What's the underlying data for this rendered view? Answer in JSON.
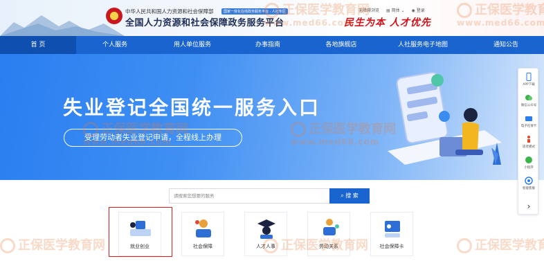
{
  "header": {
    "ministry": "中华人民共和国人力资源和社会保障部",
    "platform_title": "全国人力资源和社会保障政务服务平台",
    "tagline": "国家一体化在线政务服务平台 · 人社专区",
    "slogan": "民生为本 人才优先",
    "links": [
      "无障碍浏览",
      "简体",
      "登录"
    ]
  },
  "nav": {
    "items": [
      "首 页",
      "个人服务",
      "用人单位服务",
      "办事指南",
      "各地旗舰店",
      "人社服务电子地图",
      "通知公告"
    ],
    "active_index": 0
  },
  "banner": {
    "title": "失业登记全国统一服务入口",
    "subtitle": "受理劳动者失业登记申请，全程线上办理"
  },
  "side_tools": {
    "items": [
      "APP下载",
      "微信公众号",
      "电子社保卡",
      "适老模式",
      "小程序",
      "智能客服"
    ]
  },
  "search": {
    "placeholder": "请搜索您想要的服务",
    "button_label": "搜 索"
  },
  "services": {
    "items": [
      "就业创业",
      "社会保障",
      "人才人事",
      "劳动关系",
      "社会保障卡"
    ],
    "highlighted_index": 0
  },
  "watermark": {
    "brand": "正保医学教育网",
    "url": "www.med66.com"
  },
  "colors": {
    "primary": "#1a64cf",
    "nav_active": "#0f4fb0",
    "highlight": "#e1191e",
    "slogan": "#d0121b"
  }
}
